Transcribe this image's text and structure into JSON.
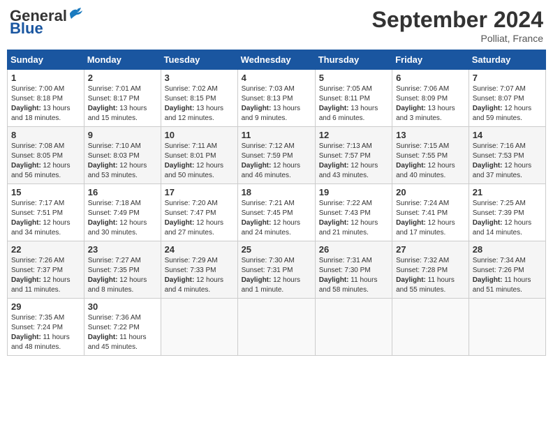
{
  "header": {
    "logo_general": "General",
    "logo_blue": "Blue",
    "month_title": "September 2024",
    "location": "Polliat, France"
  },
  "columns": [
    "Sunday",
    "Monday",
    "Tuesday",
    "Wednesday",
    "Thursday",
    "Friday",
    "Saturday"
  ],
  "rows": [
    [
      {
        "day": "1",
        "info": "Sunrise: 7:00 AM\nSunset: 8:18 PM\nDaylight: 13 hours and 18 minutes."
      },
      {
        "day": "2",
        "info": "Sunrise: 7:01 AM\nSunset: 8:17 PM\nDaylight: 13 hours and 15 minutes."
      },
      {
        "day": "3",
        "info": "Sunrise: 7:02 AM\nSunset: 8:15 PM\nDaylight: 13 hours and 12 minutes."
      },
      {
        "day": "4",
        "info": "Sunrise: 7:03 AM\nSunset: 8:13 PM\nDaylight: 13 hours and 9 minutes."
      },
      {
        "day": "5",
        "info": "Sunrise: 7:05 AM\nSunset: 8:11 PM\nDaylight: 13 hours and 6 minutes."
      },
      {
        "day": "6",
        "info": "Sunrise: 7:06 AM\nSunset: 8:09 PM\nDaylight: 13 hours and 3 minutes."
      },
      {
        "day": "7",
        "info": "Sunrise: 7:07 AM\nSunset: 8:07 PM\nDaylight: 12 hours and 59 minutes."
      }
    ],
    [
      {
        "day": "8",
        "info": "Sunrise: 7:08 AM\nSunset: 8:05 PM\nDaylight: 12 hours and 56 minutes."
      },
      {
        "day": "9",
        "info": "Sunrise: 7:10 AM\nSunset: 8:03 PM\nDaylight: 12 hours and 53 minutes."
      },
      {
        "day": "10",
        "info": "Sunrise: 7:11 AM\nSunset: 8:01 PM\nDaylight: 12 hours and 50 minutes."
      },
      {
        "day": "11",
        "info": "Sunrise: 7:12 AM\nSunset: 7:59 PM\nDaylight: 12 hours and 46 minutes."
      },
      {
        "day": "12",
        "info": "Sunrise: 7:13 AM\nSunset: 7:57 PM\nDaylight: 12 hours and 43 minutes."
      },
      {
        "day": "13",
        "info": "Sunrise: 7:15 AM\nSunset: 7:55 PM\nDaylight: 12 hours and 40 minutes."
      },
      {
        "day": "14",
        "info": "Sunrise: 7:16 AM\nSunset: 7:53 PM\nDaylight: 12 hours and 37 minutes."
      }
    ],
    [
      {
        "day": "15",
        "info": "Sunrise: 7:17 AM\nSunset: 7:51 PM\nDaylight: 12 hours and 34 minutes."
      },
      {
        "day": "16",
        "info": "Sunrise: 7:18 AM\nSunset: 7:49 PM\nDaylight: 12 hours and 30 minutes."
      },
      {
        "day": "17",
        "info": "Sunrise: 7:20 AM\nSunset: 7:47 PM\nDaylight: 12 hours and 27 minutes."
      },
      {
        "day": "18",
        "info": "Sunrise: 7:21 AM\nSunset: 7:45 PM\nDaylight: 12 hours and 24 minutes."
      },
      {
        "day": "19",
        "info": "Sunrise: 7:22 AM\nSunset: 7:43 PM\nDaylight: 12 hours and 21 minutes."
      },
      {
        "day": "20",
        "info": "Sunrise: 7:24 AM\nSunset: 7:41 PM\nDaylight: 12 hours and 17 minutes."
      },
      {
        "day": "21",
        "info": "Sunrise: 7:25 AM\nSunset: 7:39 PM\nDaylight: 12 hours and 14 minutes."
      }
    ],
    [
      {
        "day": "22",
        "info": "Sunrise: 7:26 AM\nSunset: 7:37 PM\nDaylight: 12 hours and 11 minutes."
      },
      {
        "day": "23",
        "info": "Sunrise: 7:27 AM\nSunset: 7:35 PM\nDaylight: 12 hours and 8 minutes."
      },
      {
        "day": "24",
        "info": "Sunrise: 7:29 AM\nSunset: 7:33 PM\nDaylight: 12 hours and 4 minutes."
      },
      {
        "day": "25",
        "info": "Sunrise: 7:30 AM\nSunset: 7:31 PM\nDaylight: 12 hours and 1 minute."
      },
      {
        "day": "26",
        "info": "Sunrise: 7:31 AM\nSunset: 7:30 PM\nDaylight: 11 hours and 58 minutes."
      },
      {
        "day": "27",
        "info": "Sunrise: 7:32 AM\nSunset: 7:28 PM\nDaylight: 11 hours and 55 minutes."
      },
      {
        "day": "28",
        "info": "Sunrise: 7:34 AM\nSunset: 7:26 PM\nDaylight: 11 hours and 51 minutes."
      }
    ],
    [
      {
        "day": "29",
        "info": "Sunrise: 7:35 AM\nSunset: 7:24 PM\nDaylight: 11 hours and 48 minutes."
      },
      {
        "day": "30",
        "info": "Sunrise: 7:36 AM\nSunset: 7:22 PM\nDaylight: 11 hours and 45 minutes."
      },
      {
        "day": "",
        "info": ""
      },
      {
        "day": "",
        "info": ""
      },
      {
        "day": "",
        "info": ""
      },
      {
        "day": "",
        "info": ""
      },
      {
        "day": "",
        "info": ""
      }
    ]
  ]
}
